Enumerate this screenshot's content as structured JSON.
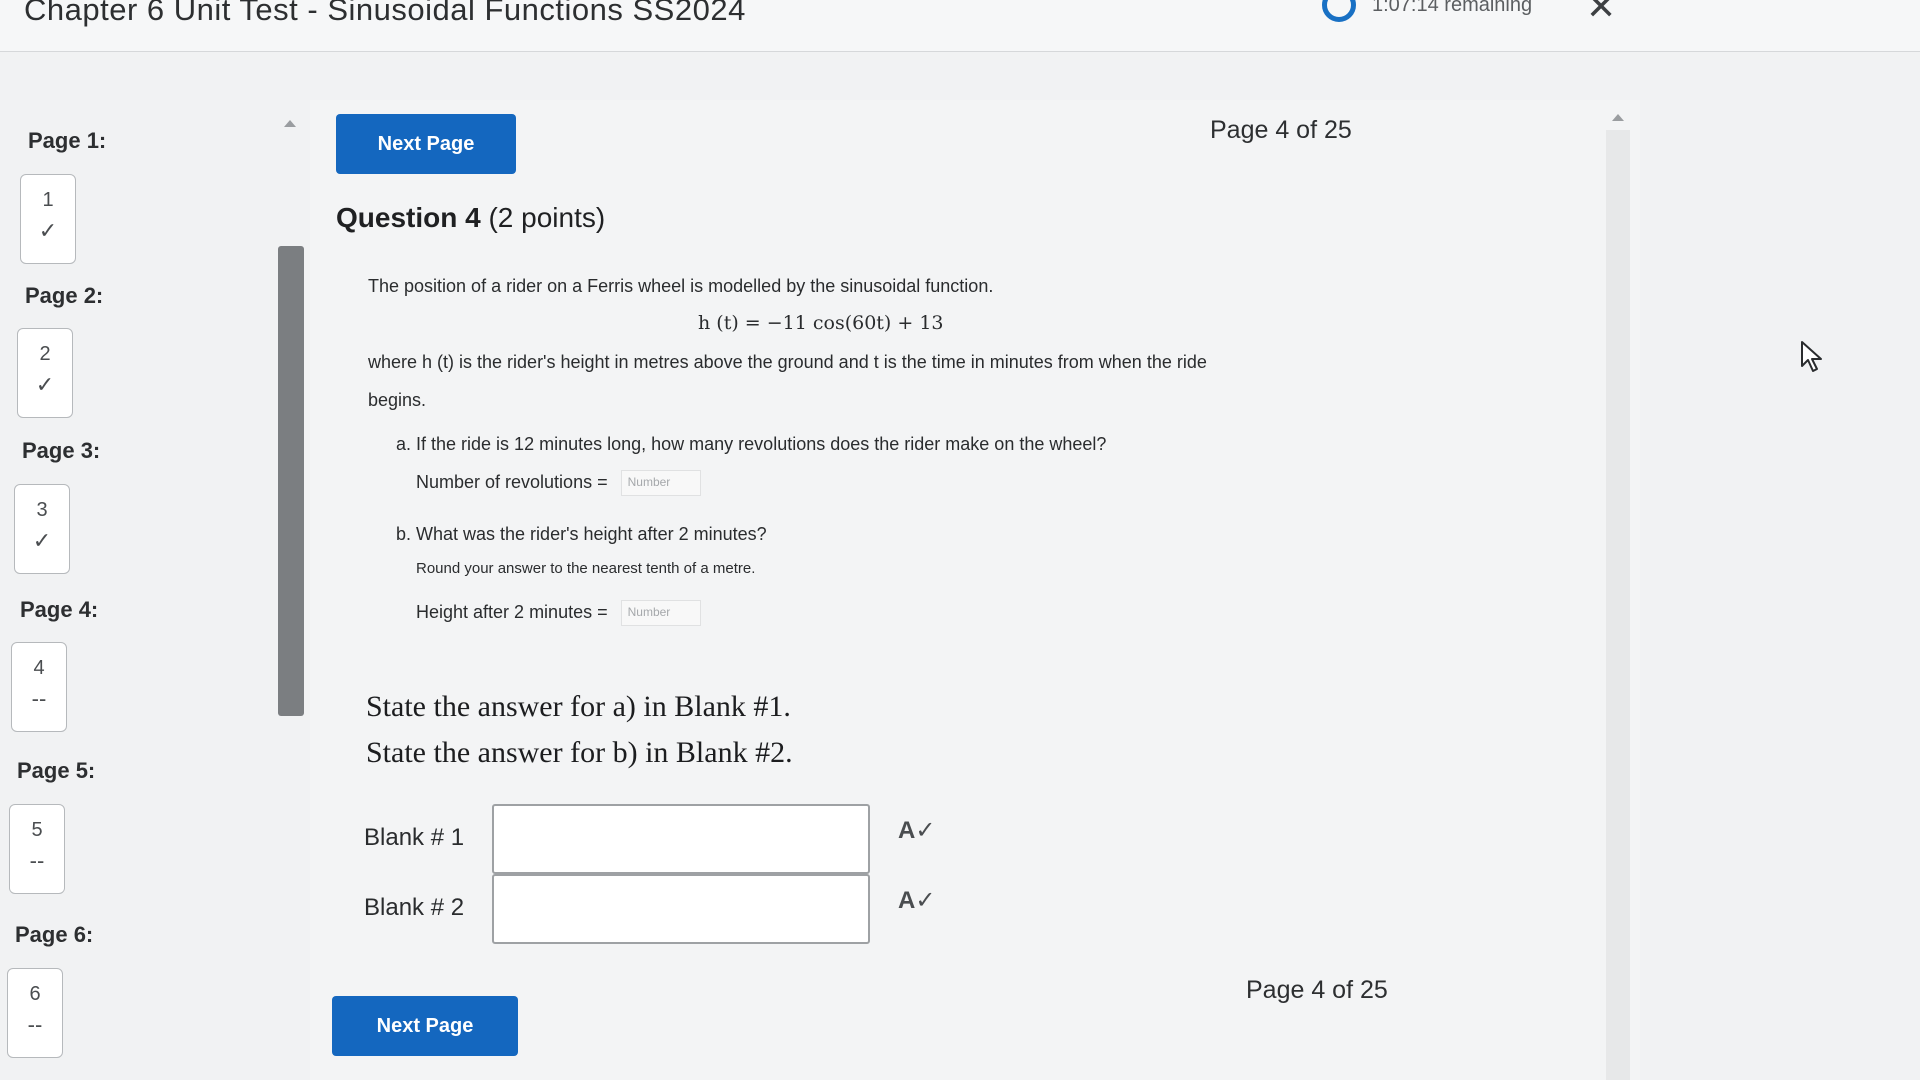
{
  "header": {
    "title": "Chapter 6 Unit Test - Sinusoidal Functions SS2024",
    "timer": "1:07:14 remaining",
    "close_icon": "✕"
  },
  "nav": {
    "pages": [
      {
        "label": "Page 1:",
        "number": "1",
        "status": "✓"
      },
      {
        "label": "Page 2:",
        "number": "2",
        "status": "✓"
      },
      {
        "label": "Page 3:",
        "number": "3",
        "status": "✓"
      },
      {
        "label": "Page 4:",
        "number": "4",
        "status": "--"
      },
      {
        "label": "Page 5:",
        "number": "5",
        "status": "--"
      },
      {
        "label": "Page 6:",
        "number": "6",
        "status": "--"
      }
    ]
  },
  "main": {
    "next_label": "Next Page",
    "page_indicator": "Page 4 of 25",
    "question_number": "Question 4",
    "points": "(2 points)",
    "intro": "The position of a rider on a Ferris wheel is modelled by the sinusoidal function.",
    "formula": "h (t) = −11 cos(60t) + 13",
    "where_line1": "where h (t) is the rider's height in metres above the ground and t is the time in minutes from when the ride",
    "where_line2": "begins.",
    "part_a": "a. If the ride is 12 minutes long, how many revolutions does the rider make on the wheel?",
    "part_a_label": "Number of revolutions =",
    "part_a_placeholder": "Number",
    "part_b": "b. What was the rider's height after 2 minutes?",
    "part_b_note": "Round your answer to the nearest tenth of a metre.",
    "part_b_label": "Height after 2 minutes =",
    "part_b_placeholder": "Number",
    "instruction_a": "State the answer for a) in  Blank #1.",
    "instruction_b": "State the answer for b) in  Blank #2.",
    "blank1_label": "Blank # 1",
    "blank2_label": "Blank # 2",
    "blank1_value": "",
    "blank2_value": "",
    "spellcheck_icon": "A✓"
  },
  "colors": {
    "accent": "#1467bf",
    "timer_ring": "#1870c4"
  }
}
